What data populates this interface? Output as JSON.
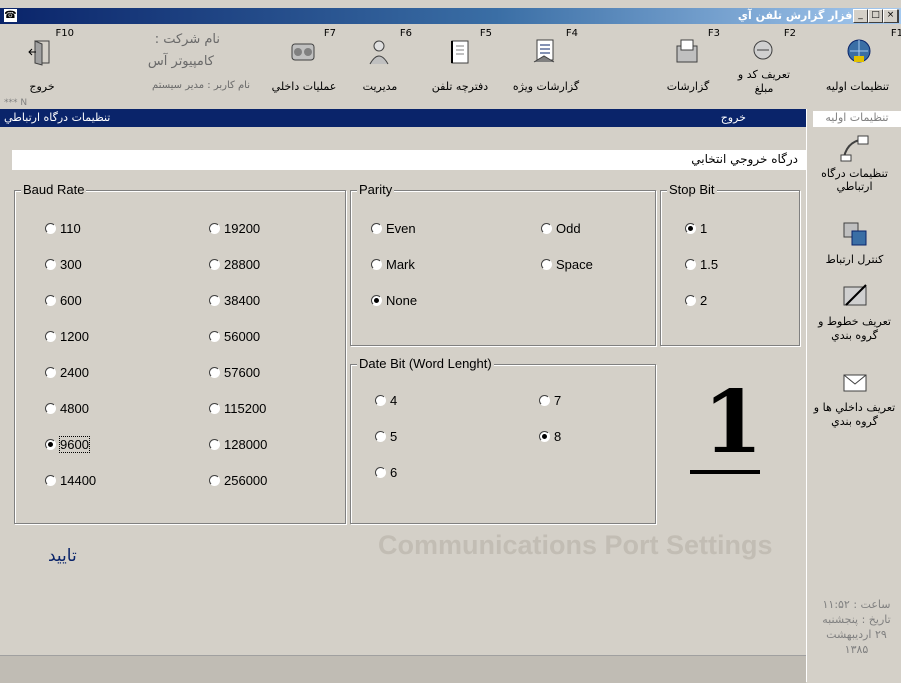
{
  "window": {
    "title": "نرم افزار گزارش تلفن آي"
  },
  "toolbar": {
    "company_label": "نام شرکت :",
    "company_name": "کامپیوتر آس",
    "user_label": "نام کاربر : مدير سيستم",
    "items": [
      {
        "key": "F10",
        "label": "خروج",
        "icon": "exit-door-icon"
      },
      {
        "key": "F7",
        "label": "عمليات داخلي",
        "icon": "operations-icon"
      },
      {
        "key": "F6",
        "label": "مديريت",
        "icon": "management-icon"
      },
      {
        "key": "F5",
        "label": "دفترچه تلفن",
        "icon": "phonebook-icon"
      },
      {
        "key": "F4",
        "label": "گزارشات ويژه",
        "icon": "special-reports-icon"
      },
      {
        "key": "F3",
        "label": "گزارشات",
        "icon": "reports-icon"
      },
      {
        "key": "F2",
        "label": "تعريف کد و مبلغ",
        "icon": "code-amount-icon"
      },
      {
        "key": "F1",
        "label": "تنظيمات اوليه",
        "icon": "initial-settings-icon"
      }
    ],
    "status_small": "*** N"
  },
  "bluebar": {
    "title": "تنظيمات درگاه ارتباطي",
    "exit": "خروج"
  },
  "right_panel": {
    "header": "تنظيمات اوليه",
    "items": [
      {
        "label": "تنظيمات درگاه ارتباطي",
        "icon": "port-settings-icon"
      },
      {
        "label": "کنترل ارتباط",
        "icon": "connection-control-icon"
      },
      {
        "label": "تعريف خطوط و گروه بندي",
        "icon": "lines-define-icon"
      },
      {
        "label": "تعريف داخلي ها و گروه بندي",
        "icon": "extensions-define-icon"
      }
    ],
    "clock": {
      "time": "ساعت : ۱۱:۵۲",
      "date_label": "تاريخ : پنجشنبه",
      "date_day": "۲۹ ارديبهشت",
      "date_year": "۱۳۸۵"
    }
  },
  "output_port_label": "درگاه خروجي انتخابي",
  "baud_rate": {
    "title": "Baud Rate",
    "options": [
      "110",
      "300",
      "600",
      "1200",
      "2400",
      "4800",
      "9600",
      "14400",
      "19200",
      "28800",
      "38400",
      "56000",
      "57600",
      "115200",
      "128000",
      "256000"
    ],
    "selected": "9600"
  },
  "parity": {
    "title": "Parity",
    "options": [
      "Even",
      "Odd",
      "Mark",
      "Space",
      "None"
    ],
    "selected": "None"
  },
  "stop_bit": {
    "title": "Stop Bit",
    "options": [
      "1",
      "1.5",
      "2"
    ],
    "selected": "1"
  },
  "data_bit": {
    "title": "Date Bit (Word Lenght)",
    "options": [
      "4",
      "7",
      "5",
      "8",
      "6"
    ],
    "selected": "8"
  },
  "port_number": "1",
  "confirm_label": "تاييد",
  "heading": "Communications Port Settings"
}
